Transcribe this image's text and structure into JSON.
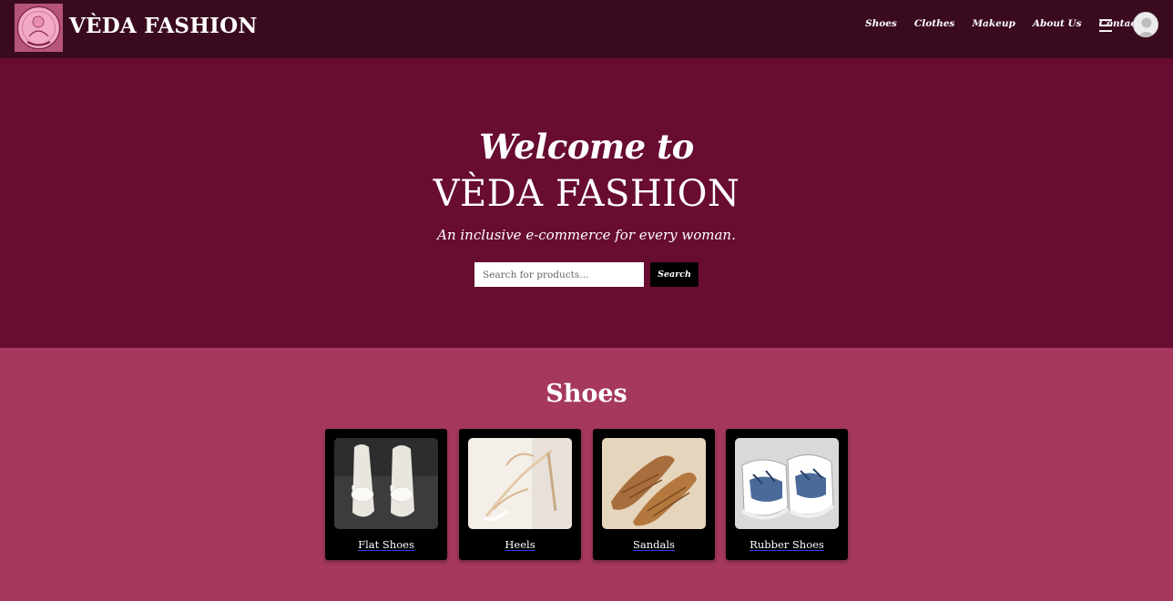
{
  "header": {
    "brand": "VÈDA FASHION",
    "nav": [
      "Shoes",
      "Clothes",
      "Makeup",
      "About Us",
      "Contact"
    ],
    "menu_icon": "hamburger-icon",
    "avatar_icon": "user-avatar-icon"
  },
  "hero": {
    "welcome": "Welcome to",
    "title": "VÈDA FASHION",
    "tagline": "An inclusive e-commerce for every woman.",
    "search_placeholder": "Search for products...",
    "search_button": "Search"
  },
  "shoes": {
    "title": "Shoes",
    "items": [
      {
        "label": "Flat Shoes"
      },
      {
        "label": "Heels"
      },
      {
        "label": "Sandals"
      },
      {
        "label": "Rubber Shoes"
      }
    ]
  },
  "colors": {
    "header_bg": "#3a0a1f",
    "hero_bg": "#680c31",
    "section_bg": "#a6385f",
    "card_bg": "#000000"
  }
}
